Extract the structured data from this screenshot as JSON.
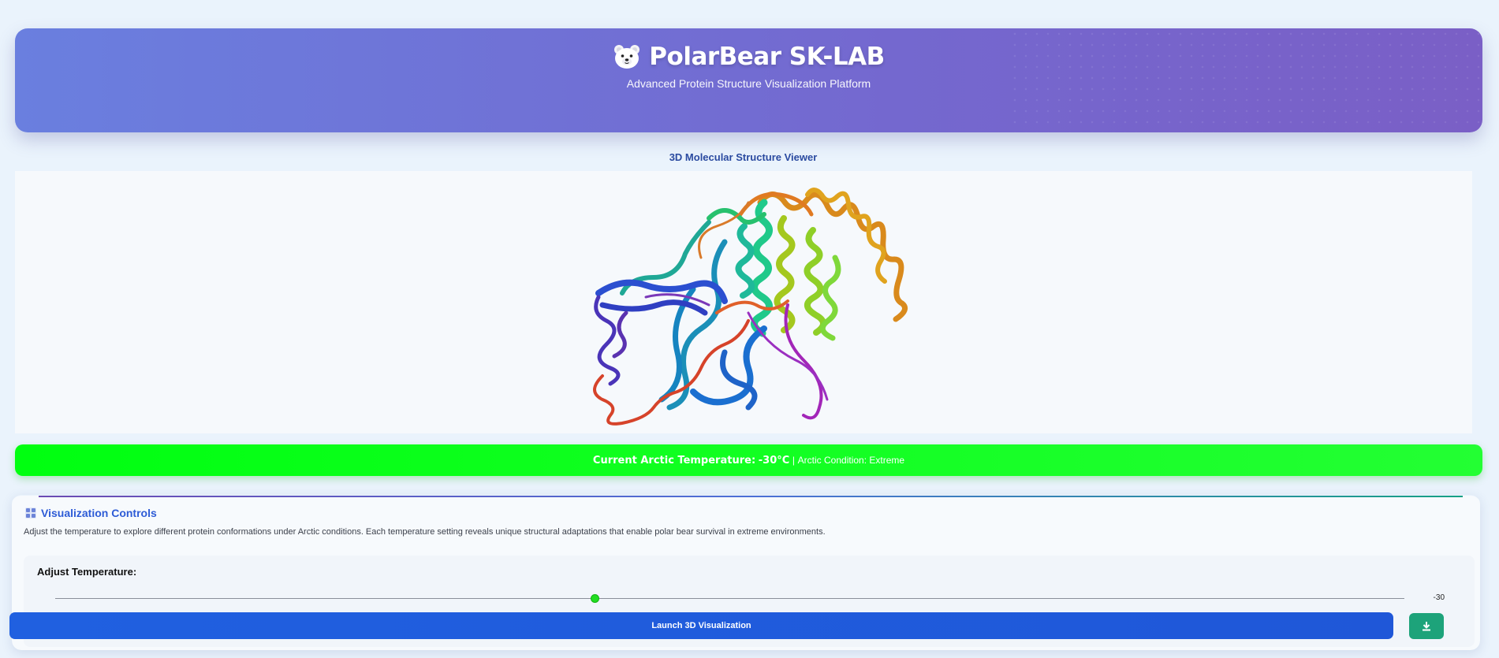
{
  "header": {
    "title": "PolarBear SK-LAB",
    "subtitle": "Advanced Protein Structure Visualization Platform",
    "logo_icon": "polar-bear-face-icon"
  },
  "viewer": {
    "label": "3D Molecular Structure Viewer",
    "content": "protein-ribbon-structure"
  },
  "status_banner": {
    "temperature_label": "Current Arctic Temperature:",
    "temperature_value": "-30°C",
    "separator": "|",
    "condition_text": "Arctic Condition: Extreme",
    "color": "#00ff10"
  },
  "controls": {
    "title": "Visualization Controls",
    "icon": "grid-icon",
    "description": "Adjust the temperature to explore different protein conformations under Arctic conditions. Each temperature setting reveals unique structural adaptations that enable polar bear survival in extreme environments.",
    "slider": {
      "label": "Adjust Temperature:",
      "value": "-30",
      "position_fraction": 0.4
    },
    "launch_label": "Launch 3D Visualization",
    "download_icon": "download-icon",
    "accent": "#2060e0",
    "download_color": "#1da37a"
  }
}
